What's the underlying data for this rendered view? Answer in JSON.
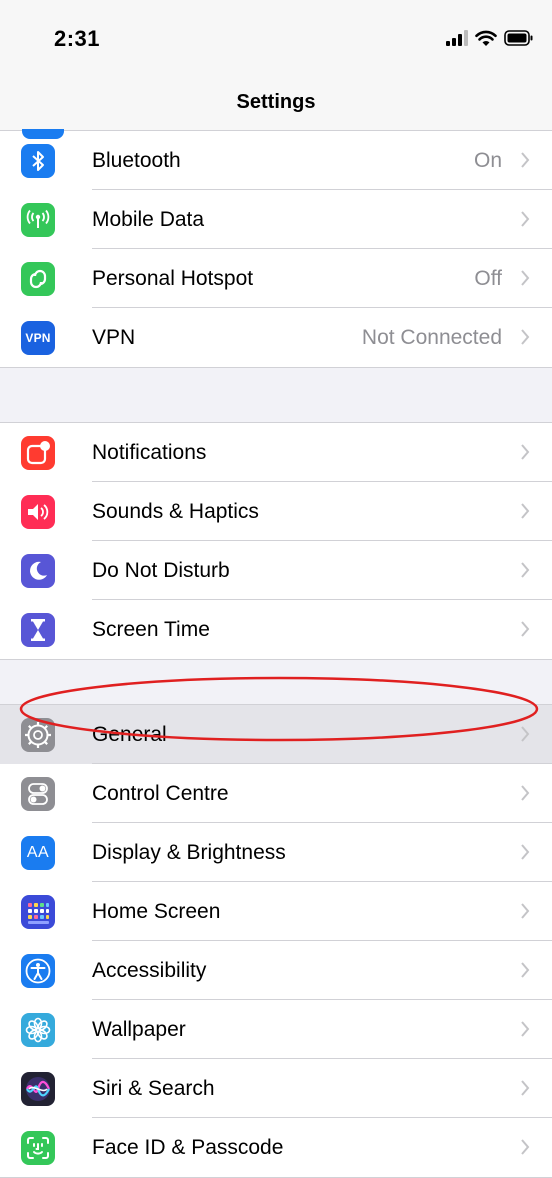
{
  "status_bar": {
    "time": "2:31"
  },
  "nav": {
    "title": "Settings"
  },
  "groups": [
    {
      "rows": [
        {
          "label": "Bluetooth",
          "value": "On",
          "icon": "bluetooth-icon",
          "color": "#1a7cf0"
        },
        {
          "label": "Mobile Data",
          "value": "",
          "icon": "antenna-icon",
          "color": "#34c759"
        },
        {
          "label": "Personal Hotspot",
          "value": "Off",
          "icon": "hotspot-icon",
          "color": "#34c759"
        },
        {
          "label": "VPN",
          "value": "Not Connected",
          "icon": "vpn-icon",
          "icon_text": "VPN",
          "color": "#1a62e0"
        }
      ]
    },
    {
      "rows": [
        {
          "label": "Notifications",
          "value": "",
          "icon": "notifications-icon",
          "color": "#ff3b30"
        },
        {
          "label": "Sounds & Haptics",
          "value": "",
          "icon": "speaker-icon",
          "color": "#ff2d55"
        },
        {
          "label": "Do Not Disturb",
          "value": "",
          "icon": "moon-icon",
          "color": "#5856d6"
        },
        {
          "label": "Screen Time",
          "value": "",
          "icon": "hourglass-icon",
          "color": "#5856d6"
        }
      ]
    },
    {
      "rows": [
        {
          "label": "General",
          "value": "",
          "icon": "gear-icon",
          "color": "#8e8e93"
        },
        {
          "label": "Control Centre",
          "value": "",
          "icon": "toggles-icon",
          "color": "#8e8e93"
        },
        {
          "label": "Display & Brightness",
          "value": "",
          "icon": "text-size-icon",
          "icon_text": "AA",
          "color": "#1a7cf0"
        },
        {
          "label": "Home Screen",
          "value": "",
          "icon": "home-screen-grid-icon",
          "color": "#3b4ad8"
        },
        {
          "label": "Accessibility",
          "value": "",
          "icon": "accessibility-icon",
          "color": "#1a7cf0"
        },
        {
          "label": "Wallpaper",
          "value": "",
          "icon": "flower-icon",
          "color": "#35aadc"
        },
        {
          "label": "Siri & Search",
          "value": "",
          "icon": "siri-icon",
          "color": "#222233"
        },
        {
          "label": "Face ID & Passcode",
          "value": "",
          "icon": "face-id-icon",
          "color": "#34c759"
        }
      ]
    }
  ],
  "annotation": {
    "color": "#e02020",
    "target": "General"
  }
}
